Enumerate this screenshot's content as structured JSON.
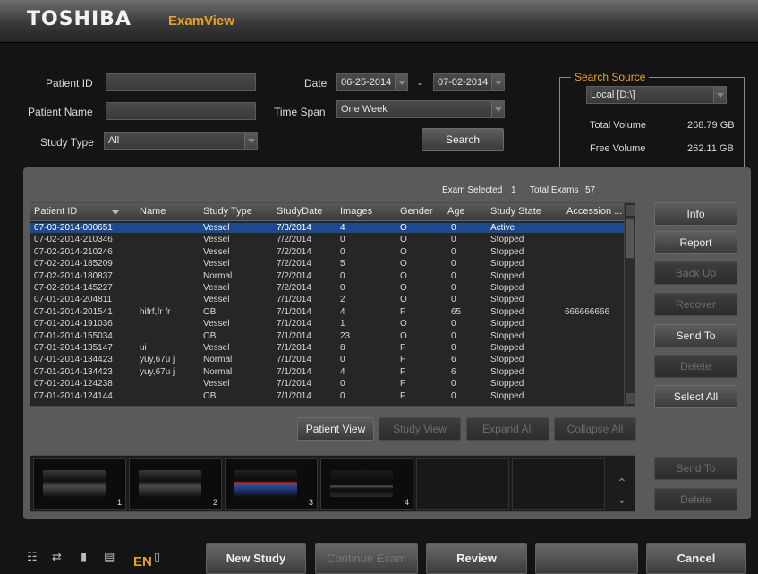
{
  "header": {
    "brand": "TOSHIBA",
    "app_name": "ExamView"
  },
  "search": {
    "patient_id_label": "Patient ID",
    "patient_id_value": "",
    "patient_name_label": "Patient Name",
    "patient_name_value": "",
    "study_type_label": "Study Type",
    "study_type_value": "All",
    "date_label": "Date",
    "date_from": "06-25-2014",
    "date_sep": "-",
    "date_to": "07-02-2014",
    "time_span_label": "Time Span",
    "time_span_value": "One Week",
    "search_button": "Search"
  },
  "source": {
    "title": "Search Source",
    "location": "Local [D:\\]",
    "total_volume_label": "Total Volume",
    "total_volume_value": "268.79 GB",
    "free_volume_label": "Free Volume",
    "free_volume_value": "262.11 GB"
  },
  "summary": {
    "selected_label": "Exam Selected",
    "selected_value": "1",
    "total_label": "Total Exams",
    "total_value": "57"
  },
  "table": {
    "columns": [
      "Patient ID",
      "Name",
      "Study Type",
      "StudyDate",
      "Images",
      "Gender",
      "Age",
      "Study State",
      "Accession ..."
    ],
    "rows": [
      [
        "07-03-2014-000651",
        "",
        "Vessel",
        "7/3/2014",
        "4",
        "O",
        "0",
        "Active",
        ""
      ],
      [
        "07-02-2014-210346",
        "",
        "Vessel",
        "7/2/2014",
        "0",
        "O",
        "0",
        "Stopped",
        ""
      ],
      [
        "07-02-2014-210246",
        "",
        "Vessel",
        "7/2/2014",
        "0",
        "O",
        "0",
        "Stopped",
        ""
      ],
      [
        "07-02-2014-185209",
        "",
        "Vessel",
        "7/2/2014",
        "5",
        "O",
        "0",
        "Stopped",
        ""
      ],
      [
        "07-02-2014-180837",
        "",
        "Normal",
        "7/2/2014",
        "0",
        "O",
        "0",
        "Stopped",
        ""
      ],
      [
        "07-02-2014-145227",
        "",
        "Vessel",
        "7/2/2014",
        "0",
        "O",
        "0",
        "Stopped",
        ""
      ],
      [
        "07-01-2014-204811",
        "",
        "Vessel",
        "7/1/2014",
        "2",
        "O",
        "0",
        "Stopped",
        ""
      ],
      [
        "07-01-2014-201541",
        "hifrf,fr fr",
        "OB",
        "7/1/2014",
        "4",
        "F",
        "65",
        "Stopped",
        "666666666"
      ],
      [
        "07-01-2014-191036",
        "",
        "Vessel",
        "7/1/2014",
        "1",
        "O",
        "0",
        "Stopped",
        ""
      ],
      [
        "07-01-2014-155034",
        "",
        "OB",
        "7/1/2014",
        "23",
        "O",
        "0",
        "Stopped",
        ""
      ],
      [
        "07-01-2014-135147",
        "ui",
        "Vessel",
        "7/1/2014",
        "8",
        "F",
        "0",
        "Stopped",
        ""
      ],
      [
        "07-01-2014-134423",
        "yuy,67u j",
        "Normal",
        "7/1/2014",
        "0",
        "F",
        "6",
        "Stopped",
        ""
      ],
      [
        "07-01-2014-134423",
        "yuy,67u j",
        "Normal",
        "7/1/2014",
        "4",
        "F",
        "6",
        "Stopped",
        ""
      ],
      [
        "07-01-2014-124238",
        "",
        "Vessel",
        "7/1/2014",
        "0",
        "F",
        "0",
        "Stopped",
        ""
      ],
      [
        "07-01-2014-124144",
        "",
        "OB",
        "7/1/2014",
        "0",
        "F",
        "0",
        "Stopped",
        ""
      ]
    ]
  },
  "side_buttons": [
    {
      "label": "Info",
      "enabled": true
    },
    {
      "label": "Report",
      "enabled": true
    },
    {
      "label": "Back Up",
      "enabled": false
    },
    {
      "label": "Recover",
      "enabled": false
    },
    {
      "label": "Send To",
      "enabled": true
    },
    {
      "label": "Delete",
      "enabled": false
    },
    {
      "label": "Select All",
      "enabled": true
    }
  ],
  "view_buttons": [
    {
      "label": "Patient View",
      "enabled": true
    },
    {
      "label": "Study View",
      "enabled": false
    },
    {
      "label": "Expand All",
      "enabled": false
    },
    {
      "label": "Collapse All",
      "enabled": false
    }
  ],
  "thumbnails": [
    "1",
    "2",
    "3",
    "4"
  ],
  "thumb_buttons": [
    {
      "label": "Send To",
      "enabled": false
    },
    {
      "label": "Delete",
      "enabled": false
    }
  ],
  "footer": {
    "language": "EN",
    "buttons": [
      {
        "label": "New Study",
        "enabled": true
      },
      {
        "label": "Continue Exam",
        "enabled": false
      },
      {
        "label": "Review",
        "enabled": true
      },
      {
        "label": "",
        "enabled": true
      },
      {
        "label": "Cancel",
        "enabled": true
      }
    ]
  },
  "colors": {
    "accent": "#e9a321",
    "selection": "#1d4a8f",
    "panel": "#5a5a5a"
  }
}
